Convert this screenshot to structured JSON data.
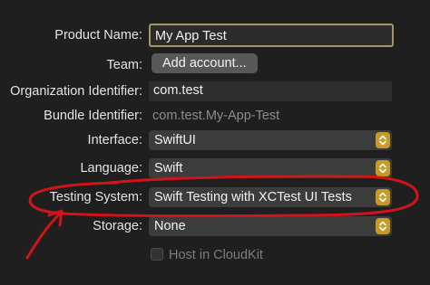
{
  "form": {
    "product_name": {
      "label": "Product Name:",
      "value": "My App Test"
    },
    "team": {
      "label": "Team:",
      "button": "Add account..."
    },
    "organization_identifier": {
      "label": "Organization Identifier:",
      "value": "com.test"
    },
    "bundle_identifier": {
      "label": "Bundle Identifier:",
      "value": "com.test.My-App-Test"
    },
    "interface": {
      "label": "Interface:",
      "value": "SwiftUI"
    },
    "language": {
      "label": "Language:",
      "value": "Swift"
    },
    "testing_system": {
      "label": "Testing System:",
      "value": "Swift Testing with XCTest UI Tests"
    },
    "storage": {
      "label": "Storage:",
      "value": "None"
    },
    "host_in_cloudkit": {
      "label": "Host in CloudKit",
      "checked": false
    }
  },
  "colors": {
    "background": "#1f1f1f",
    "popup_chevron": "#c89a2a",
    "focus_ring": "#a29865",
    "annotation": "#d0141a"
  },
  "icons": {
    "popup_chevron": "chevron-up-down-icon"
  }
}
